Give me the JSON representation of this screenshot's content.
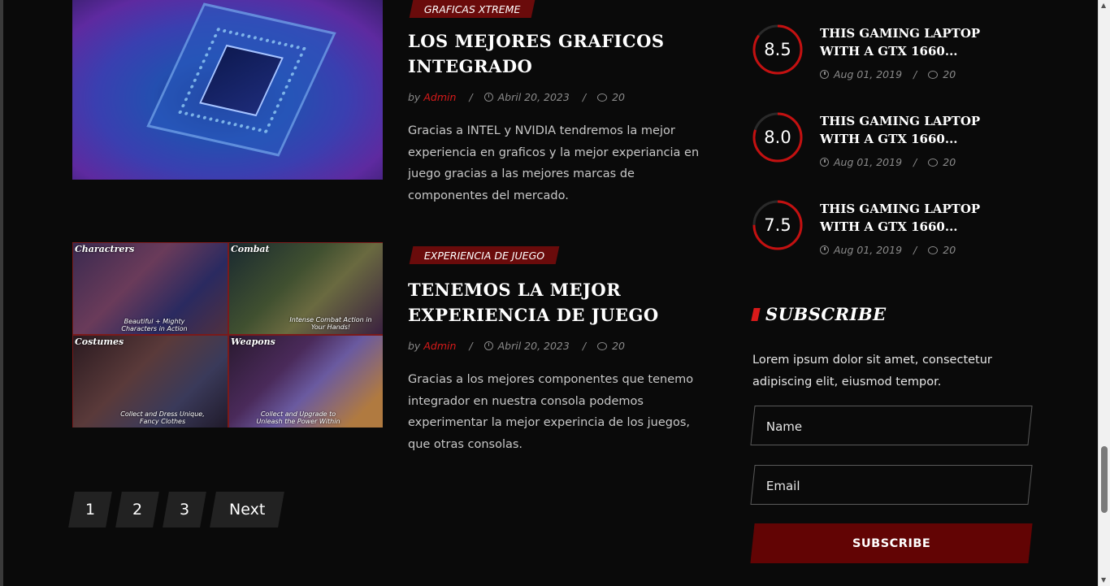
{
  "posts": [
    {
      "category": "GRAFICAS XTREME",
      "title": "LOS MEJORES GRAFICOS INTEGRADO",
      "by": "by",
      "author": "Admin",
      "date": "Abril 20, 2023",
      "comments": "20",
      "excerpt": "Gracias a INTEL y NVIDIA tendremos la mejor experiencia en graficos y la mejor experiancia en juego gracias a las mejores marcas de componentes del mercado.",
      "image_icon": "cpu-chip-image"
    },
    {
      "category": "EXPERIENCIA DE JUEGO",
      "title": "TENEMOS LA MEJOR EXPERIENCIA DE JUEGO",
      "by": "by",
      "author": "Admin",
      "date": "Abril 20, 2023",
      "comments": "20",
      "excerpt": "Gracias a los mejores componentes que tenemo integrador en nuestra consola podemos experimentar la mejor experincia de los juegos, que otras consolas.",
      "image_icon": "game-collage-image",
      "image_tiles": [
        {
          "label": "Charactrers",
          "caption": "Beautiful + Mighty Characters in Action"
        },
        {
          "label": "Combat",
          "caption": "Intense Combat Action in Your Hands!"
        },
        {
          "label": "Costumes",
          "caption": "Collect and Dress Unique, Fancy Clothes"
        },
        {
          "label": "Weapons",
          "caption": "Collect and Upgrade to Unleash the Power Within"
        }
      ]
    }
  ],
  "pagination": {
    "pages": [
      "1",
      "2",
      "3"
    ],
    "next": "Next"
  },
  "reviews": [
    {
      "score": "8.5",
      "score_fraction": 0.85,
      "title": "THIS GAMING LAPTOP WITH A GTX 1660...",
      "date": "Aug 01, 2019",
      "comments": "20"
    },
    {
      "score": "8.0",
      "score_fraction": 0.8,
      "title": "THIS GAMING LAPTOP WITH A GTX 1660...",
      "date": "Aug 01, 2019",
      "comments": "20"
    },
    {
      "score": "7.5",
      "score_fraction": 0.75,
      "title": "THIS GAMING LAPTOP WITH A GTX 1660...",
      "date": "Aug 01, 2019",
      "comments": "20"
    }
  ],
  "subscribe": {
    "title": "SUBSCRIBE",
    "text": "Lorem ipsum dolor sit amet, consectetur adipiscing elit, eiusmod tempor.",
    "name_placeholder": "Name",
    "email_placeholder": "Email",
    "button": "SUBSCRIBE"
  },
  "meta_separator": "/",
  "colors": {
    "accent": "#d81a1a",
    "badge": "#6a0b0b",
    "button": "#620404",
    "background": "#0a0a0a"
  }
}
